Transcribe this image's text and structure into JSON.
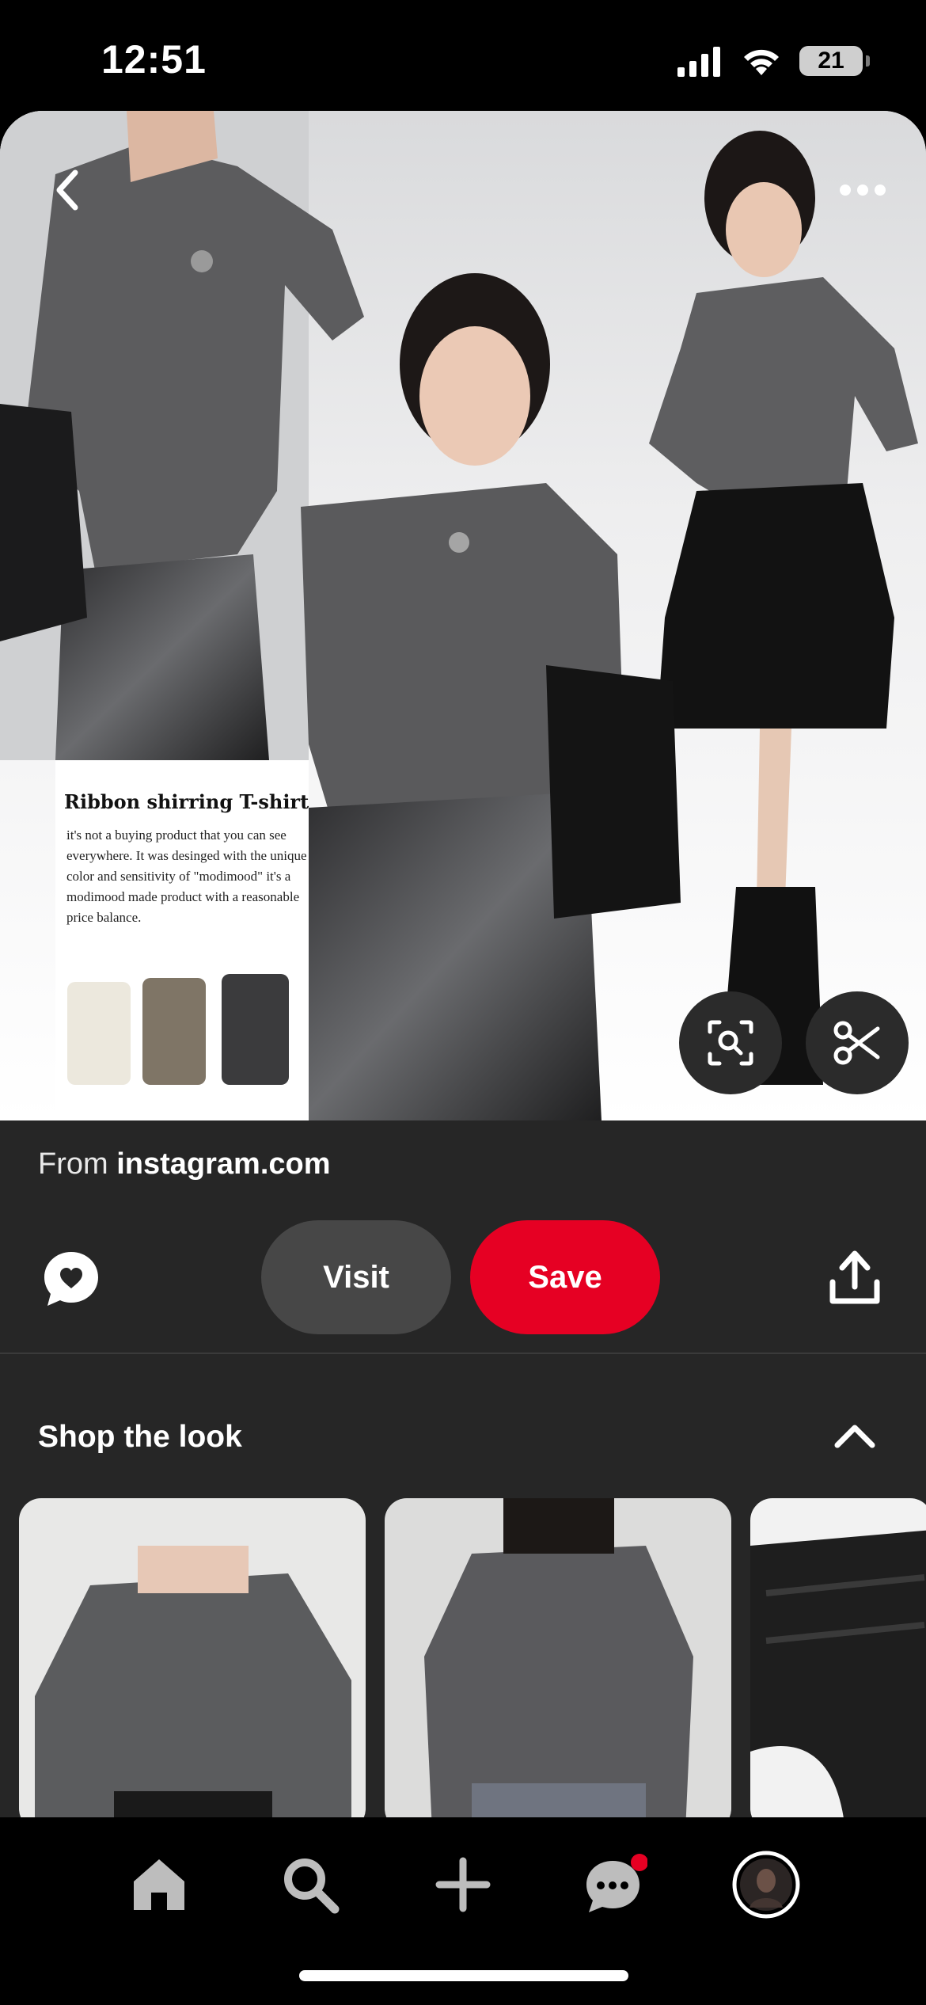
{
  "status_bar": {
    "time": "12:51",
    "battery": "21"
  },
  "pin": {
    "ad_title": "Ribbon shirring T-shirt",
    "ad_body": "it's not a buying product that you can see everywhere. It was desinged with the unique color and sensitivity of \"modimood\" it's a modimood made product with a reasonable price balance."
  },
  "source": {
    "prefix": "From",
    "domain": "instagram.com"
  },
  "actions": {
    "visit_label": "Visit",
    "save_label": "Save"
  },
  "shop": {
    "title": "Shop the look"
  },
  "colors": {
    "save": "#e60023",
    "panel": "#262626",
    "notification": "#e60023"
  },
  "nav": {
    "items": [
      "home-icon",
      "search-icon",
      "create-icon",
      "messages-icon",
      "profile-avatar"
    ]
  }
}
